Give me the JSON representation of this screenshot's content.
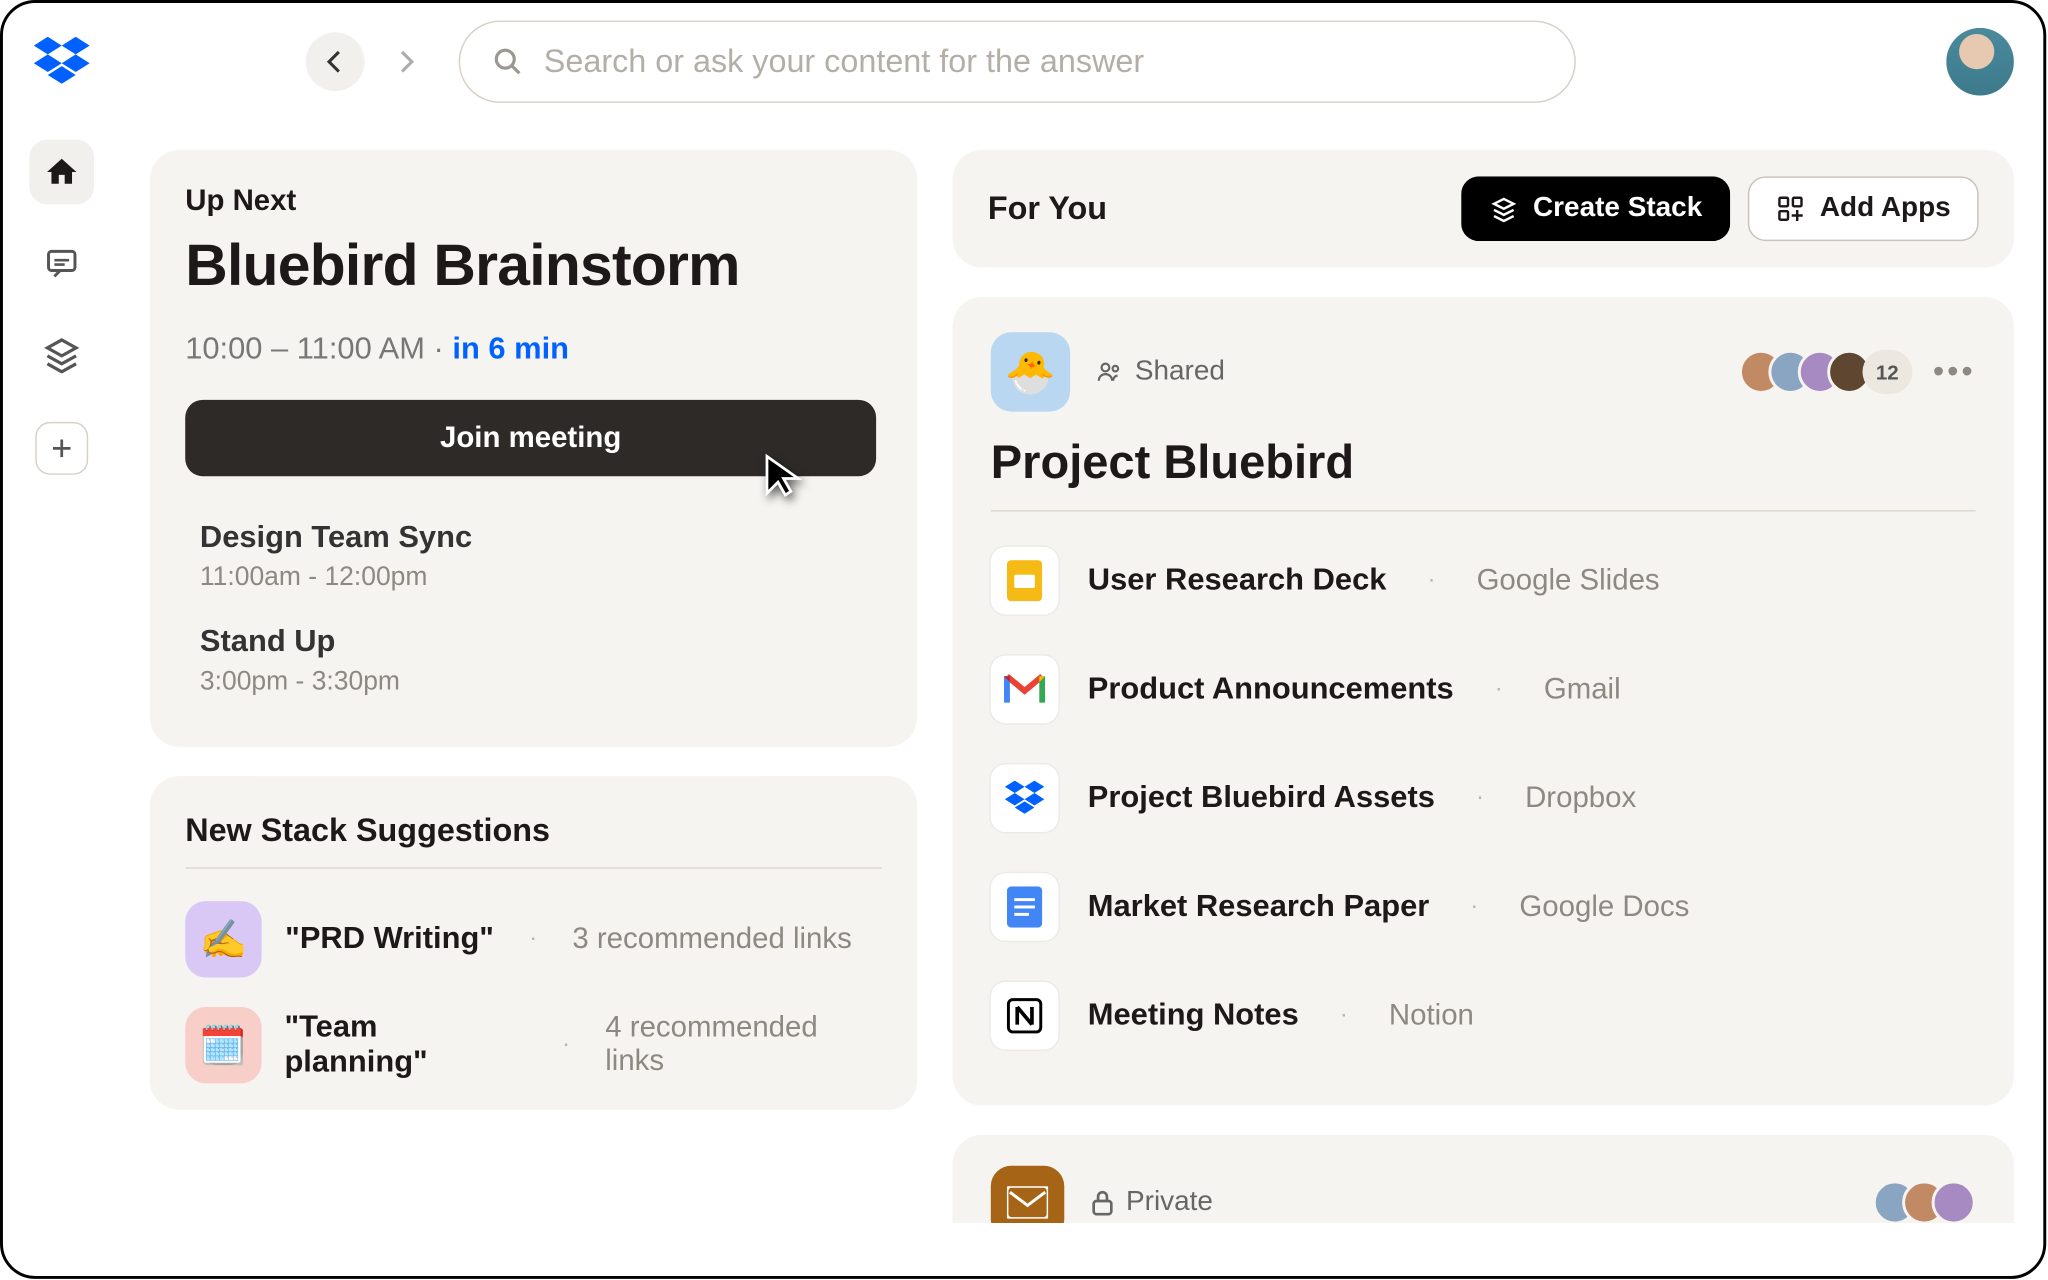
{
  "search": {
    "placeholder": "Search or ask your content for the answer"
  },
  "upnext": {
    "label": "Up Next",
    "title": "Bluebird Brainstorm",
    "time_range": "10:00 – 11:00 AM",
    "eta": "in 6 min",
    "join_label": "Join meeting",
    "schedule": [
      {
        "title": "Design Team Sync",
        "time": "11:00am - 12:00pm"
      },
      {
        "title": "Stand Up",
        "time": "3:00pm - 3:30pm"
      }
    ]
  },
  "suggestions": {
    "heading": "New Stack Suggestions",
    "items": [
      {
        "emoji": "✍️",
        "name": "\"PRD Writing\"",
        "count": "3 recommended links"
      },
      {
        "emoji": "🗓️",
        "name": "\"Team planning\"",
        "count": "4 recommended links"
      }
    ]
  },
  "foryou": {
    "heading": "For You",
    "create_label": "Create Stack",
    "add_apps_label": "Add Apps"
  },
  "stack": {
    "emoji": "🐣",
    "shared_label": "Shared",
    "overflow_count": "12",
    "title": "Project Bluebird",
    "files": [
      {
        "icon": "gslides",
        "name": "User Research Deck",
        "source": "Google Slides"
      },
      {
        "icon": "gmail",
        "name": "Product Announcements",
        "source": "Gmail"
      },
      {
        "icon": "dropbox",
        "name": "Project Bluebird Assets",
        "source": "Dropbox"
      },
      {
        "icon": "gdocs",
        "name": "Market Research Paper",
        "source": "Google Docs"
      },
      {
        "icon": "notion",
        "name": "Meeting Notes",
        "source": "Notion"
      }
    ]
  },
  "stack2": {
    "private_label": "Private"
  }
}
